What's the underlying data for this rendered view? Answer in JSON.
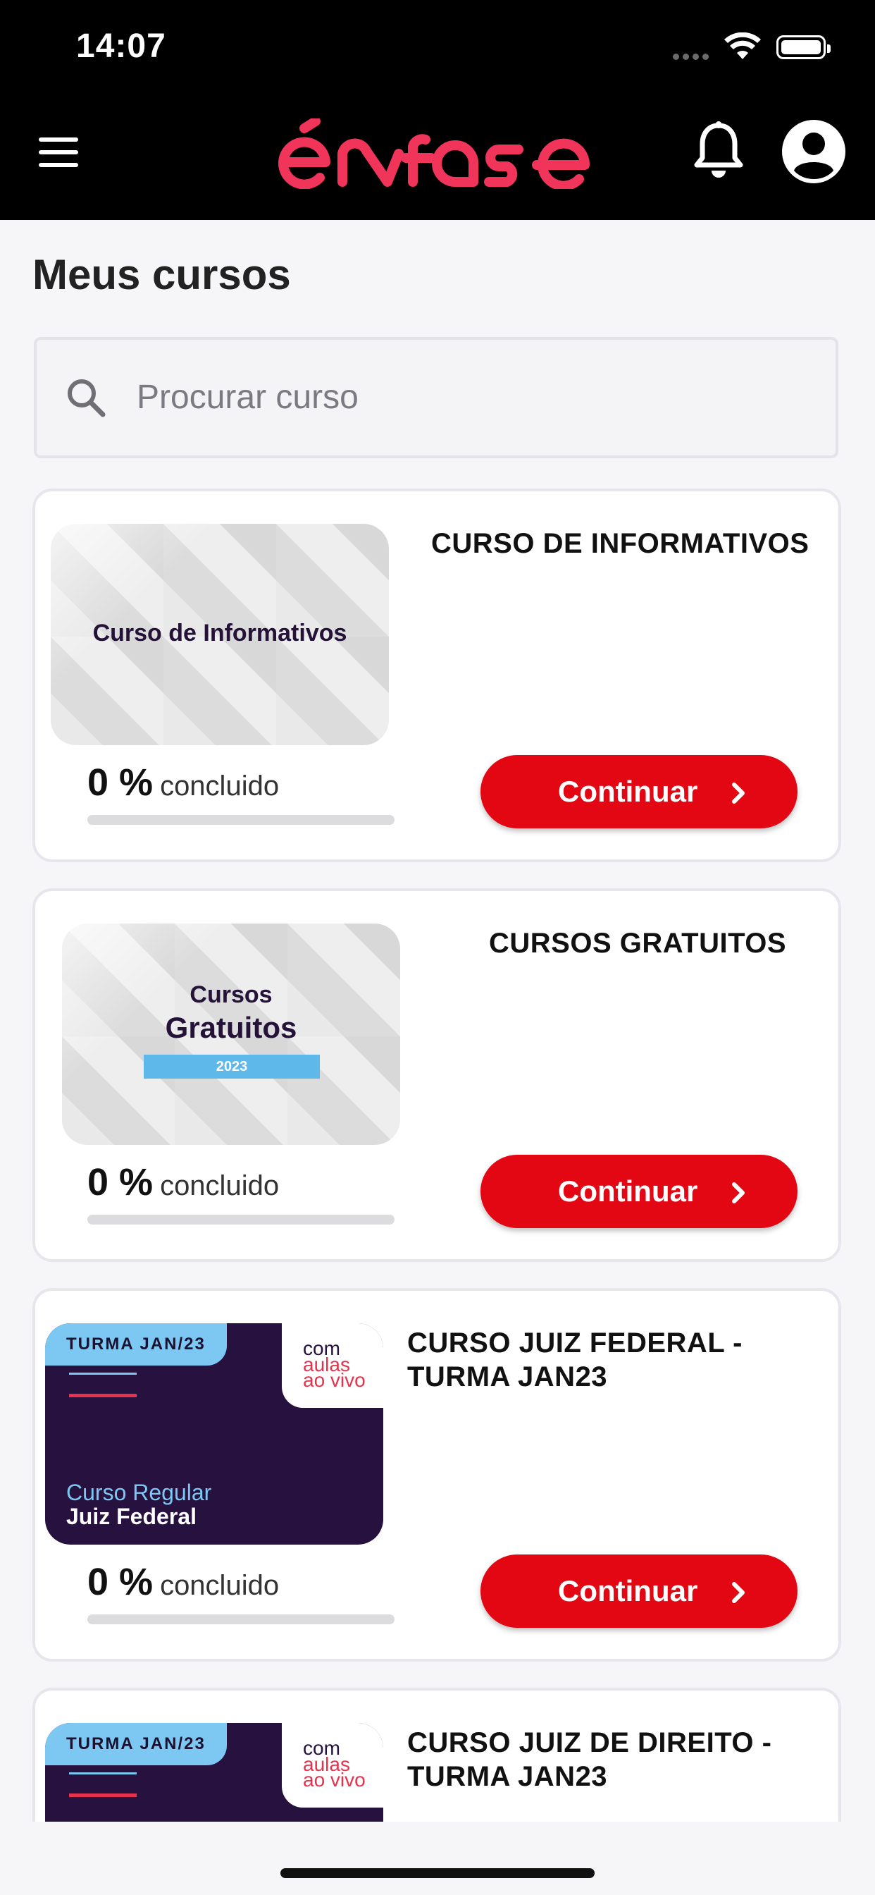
{
  "status_bar": {
    "time": "14:07"
  },
  "header": {
    "menu_icon": "hamburger-menu-icon",
    "logo_text": "enfase",
    "brand_color": "#f0345a",
    "notifications_icon": "bell-icon",
    "profile_icon": "user-avatar-icon"
  },
  "page": {
    "title": "Meus cursos"
  },
  "search": {
    "placeholder": "Procurar curso",
    "value": ""
  },
  "courses": [
    {
      "title": "CURSO DE INFORMATIVOS",
      "thumb_text": "Curso de Informativos",
      "progress": "0 %",
      "progress_value": 0,
      "progress_label": "concluido",
      "button_label": "Continuar"
    },
    {
      "title": "CURSOS GRATUITOS",
      "thumb_line1": "Cursos",
      "thumb_line2": "Gratuitos",
      "thumb_year": "2023",
      "progress": "0 %",
      "progress_value": 0,
      "progress_label": "concluido",
      "button_label": "Continuar"
    },
    {
      "title_line1": "CURSO JUIZ FEDERAL -",
      "title_line2": "TURMA JAN23",
      "thumb_tag": "TURMA JAN/23",
      "thumb_com": "com",
      "thumb_aulas": "aulas",
      "thumb_aovivo": "ao vivo",
      "thumb_sub": "Curso Regular",
      "thumb_main": "Juiz Federal",
      "progress": "0 %",
      "progress_value": 0,
      "progress_label": "concluido",
      "button_label": "Continuar"
    },
    {
      "title_line1": "CURSO JUIZ DE DIREITO -",
      "title_line2": "TURMA JAN23",
      "thumb_tag": "TURMA JAN/23",
      "thumb_com": "com",
      "thumb_aulas": "aulas",
      "thumb_aovivo": "ao vivo"
    }
  ],
  "colors": {
    "accent": "#e30613",
    "background": "#f6f6f8"
  }
}
